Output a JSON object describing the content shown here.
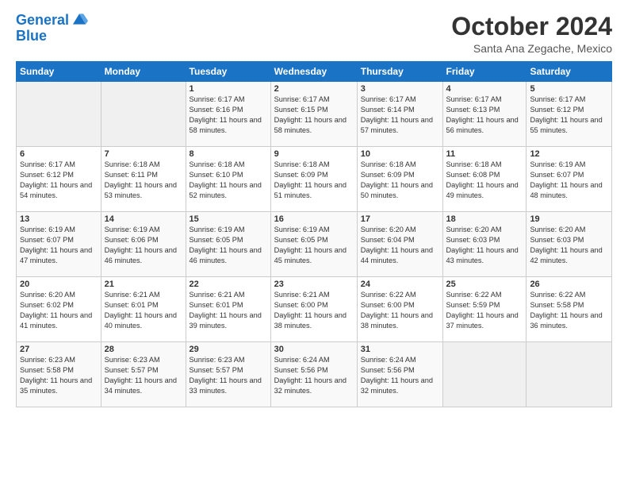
{
  "logo": {
    "line1": "General",
    "line2": "Blue"
  },
  "title": "October 2024",
  "location": "Santa Ana Zegache, Mexico",
  "days_header": [
    "Sunday",
    "Monday",
    "Tuesday",
    "Wednesday",
    "Thursday",
    "Friday",
    "Saturday"
  ],
  "rows": [
    [
      {
        "day": "",
        "sunrise": "",
        "sunset": "",
        "daylight": ""
      },
      {
        "day": "",
        "sunrise": "",
        "sunset": "",
        "daylight": ""
      },
      {
        "day": "1",
        "sunrise": "Sunrise: 6:17 AM",
        "sunset": "Sunset: 6:16 PM",
        "daylight": "Daylight: 11 hours and 58 minutes."
      },
      {
        "day": "2",
        "sunrise": "Sunrise: 6:17 AM",
        "sunset": "Sunset: 6:15 PM",
        "daylight": "Daylight: 11 hours and 58 minutes."
      },
      {
        "day": "3",
        "sunrise": "Sunrise: 6:17 AM",
        "sunset": "Sunset: 6:14 PM",
        "daylight": "Daylight: 11 hours and 57 minutes."
      },
      {
        "day": "4",
        "sunrise": "Sunrise: 6:17 AM",
        "sunset": "Sunset: 6:13 PM",
        "daylight": "Daylight: 11 hours and 56 minutes."
      },
      {
        "day": "5",
        "sunrise": "Sunrise: 6:17 AM",
        "sunset": "Sunset: 6:12 PM",
        "daylight": "Daylight: 11 hours and 55 minutes."
      }
    ],
    [
      {
        "day": "6",
        "sunrise": "Sunrise: 6:17 AM",
        "sunset": "Sunset: 6:12 PM",
        "daylight": "Daylight: 11 hours and 54 minutes."
      },
      {
        "day": "7",
        "sunrise": "Sunrise: 6:18 AM",
        "sunset": "Sunset: 6:11 PM",
        "daylight": "Daylight: 11 hours and 53 minutes."
      },
      {
        "day": "8",
        "sunrise": "Sunrise: 6:18 AM",
        "sunset": "Sunset: 6:10 PM",
        "daylight": "Daylight: 11 hours and 52 minutes."
      },
      {
        "day": "9",
        "sunrise": "Sunrise: 6:18 AM",
        "sunset": "Sunset: 6:09 PM",
        "daylight": "Daylight: 11 hours and 51 minutes."
      },
      {
        "day": "10",
        "sunrise": "Sunrise: 6:18 AM",
        "sunset": "Sunset: 6:09 PM",
        "daylight": "Daylight: 11 hours and 50 minutes."
      },
      {
        "day": "11",
        "sunrise": "Sunrise: 6:18 AM",
        "sunset": "Sunset: 6:08 PM",
        "daylight": "Daylight: 11 hours and 49 minutes."
      },
      {
        "day": "12",
        "sunrise": "Sunrise: 6:19 AM",
        "sunset": "Sunset: 6:07 PM",
        "daylight": "Daylight: 11 hours and 48 minutes."
      }
    ],
    [
      {
        "day": "13",
        "sunrise": "Sunrise: 6:19 AM",
        "sunset": "Sunset: 6:07 PM",
        "daylight": "Daylight: 11 hours and 47 minutes."
      },
      {
        "day": "14",
        "sunrise": "Sunrise: 6:19 AM",
        "sunset": "Sunset: 6:06 PM",
        "daylight": "Daylight: 11 hours and 46 minutes."
      },
      {
        "day": "15",
        "sunrise": "Sunrise: 6:19 AM",
        "sunset": "Sunset: 6:05 PM",
        "daylight": "Daylight: 11 hours and 46 minutes."
      },
      {
        "day": "16",
        "sunrise": "Sunrise: 6:19 AM",
        "sunset": "Sunset: 6:05 PM",
        "daylight": "Daylight: 11 hours and 45 minutes."
      },
      {
        "day": "17",
        "sunrise": "Sunrise: 6:20 AM",
        "sunset": "Sunset: 6:04 PM",
        "daylight": "Daylight: 11 hours and 44 minutes."
      },
      {
        "day": "18",
        "sunrise": "Sunrise: 6:20 AM",
        "sunset": "Sunset: 6:03 PM",
        "daylight": "Daylight: 11 hours and 43 minutes."
      },
      {
        "day": "19",
        "sunrise": "Sunrise: 6:20 AM",
        "sunset": "Sunset: 6:03 PM",
        "daylight": "Daylight: 11 hours and 42 minutes."
      }
    ],
    [
      {
        "day": "20",
        "sunrise": "Sunrise: 6:20 AM",
        "sunset": "Sunset: 6:02 PM",
        "daylight": "Daylight: 11 hours and 41 minutes."
      },
      {
        "day": "21",
        "sunrise": "Sunrise: 6:21 AM",
        "sunset": "Sunset: 6:01 PM",
        "daylight": "Daylight: 11 hours and 40 minutes."
      },
      {
        "day": "22",
        "sunrise": "Sunrise: 6:21 AM",
        "sunset": "Sunset: 6:01 PM",
        "daylight": "Daylight: 11 hours and 39 minutes."
      },
      {
        "day": "23",
        "sunrise": "Sunrise: 6:21 AM",
        "sunset": "Sunset: 6:00 PM",
        "daylight": "Daylight: 11 hours and 38 minutes."
      },
      {
        "day": "24",
        "sunrise": "Sunrise: 6:22 AM",
        "sunset": "Sunset: 6:00 PM",
        "daylight": "Daylight: 11 hours and 38 minutes."
      },
      {
        "day": "25",
        "sunrise": "Sunrise: 6:22 AM",
        "sunset": "Sunset: 5:59 PM",
        "daylight": "Daylight: 11 hours and 37 minutes."
      },
      {
        "day": "26",
        "sunrise": "Sunrise: 6:22 AM",
        "sunset": "Sunset: 5:58 PM",
        "daylight": "Daylight: 11 hours and 36 minutes."
      }
    ],
    [
      {
        "day": "27",
        "sunrise": "Sunrise: 6:23 AM",
        "sunset": "Sunset: 5:58 PM",
        "daylight": "Daylight: 11 hours and 35 minutes."
      },
      {
        "day": "28",
        "sunrise": "Sunrise: 6:23 AM",
        "sunset": "Sunset: 5:57 PM",
        "daylight": "Daylight: 11 hours and 34 minutes."
      },
      {
        "day": "29",
        "sunrise": "Sunrise: 6:23 AM",
        "sunset": "Sunset: 5:57 PM",
        "daylight": "Daylight: 11 hours and 33 minutes."
      },
      {
        "day": "30",
        "sunrise": "Sunrise: 6:24 AM",
        "sunset": "Sunset: 5:56 PM",
        "daylight": "Daylight: 11 hours and 32 minutes."
      },
      {
        "day": "31",
        "sunrise": "Sunrise: 6:24 AM",
        "sunset": "Sunset: 5:56 PM",
        "daylight": "Daylight: 11 hours and 32 minutes."
      },
      {
        "day": "",
        "sunrise": "",
        "sunset": "",
        "daylight": ""
      },
      {
        "day": "",
        "sunrise": "",
        "sunset": "",
        "daylight": ""
      }
    ]
  ]
}
